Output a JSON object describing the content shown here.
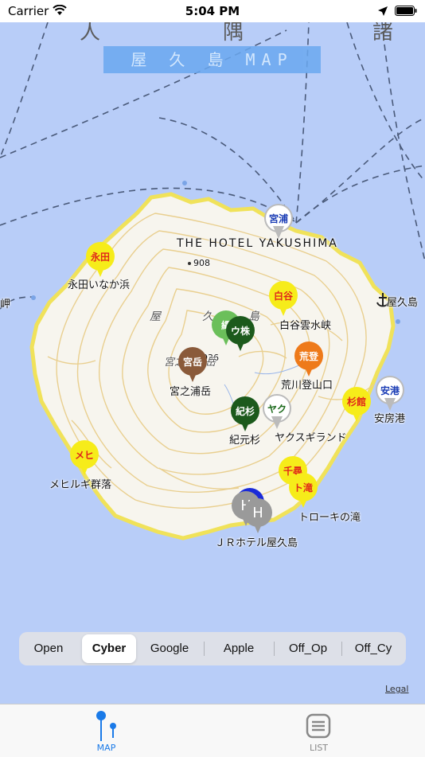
{
  "status_bar": {
    "carrier": "Carrier",
    "time": "5:04 PM"
  },
  "map": {
    "title": "屋 久 島 MAP",
    "hotel_label": "THE HOTEL YAKUSHIMA",
    "elevation_908": "908",
    "elevation_1936": "1936",
    "top_partial_1": "人",
    "top_partial_2": "隅",
    "top_partial_3": "諸",
    "left_edge_label": "岬",
    "place_labels": {
      "nagata": "永田いなか浜",
      "shiratani": "白谷雲水峡",
      "yakushima_town": "屋久島",
      "miyanoura_dake": "宮之浦岳",
      "arakawa": "荒川登山口",
      "anbo": "安房港",
      "kigensugi": "紀元杉",
      "yakusugi_land": "ヤクスギランド",
      "mehirugi": "メヒルギ群落",
      "torokinotaki": "トローキの滝",
      "jr_hotel": "ＪＲホテル屋久島",
      "map_kanji_1": "屋",
      "map_kanji_2": "久",
      "map_kanji_3": "島",
      "map_kanji_4": "宮之",
      "map_kanji_5": "岳"
    },
    "pins": {
      "miyaura": "宮浦",
      "nagata": "永田",
      "shiratani": "白谷",
      "jomon": "縄",
      "uka": "ウ株",
      "miyadake": "宮岳",
      "arato": "荒登",
      "anko": "安港",
      "sugikan": "杉館",
      "kisugi": "紀杉",
      "yaku": "ヤク",
      "mehi": "メヒ",
      "senpiro": "千尋",
      "totaki": "ト滝",
      "h1": "H",
      "h2": "H"
    }
  },
  "segmented": {
    "options": [
      "Open",
      "Cyber",
      "Google",
      "Apple",
      "Off_Op",
      "Off_Cy"
    ],
    "selected": "Cyber"
  },
  "legal": "Legal",
  "tabs": {
    "map": "MAP",
    "list": "LIST"
  },
  "colors": {
    "accent": "#1a7ae8",
    "ocean": "#b8cdf8",
    "land": "#f7f5ee",
    "contour": "#e9cf8f",
    "coast": "#f0e25a"
  }
}
